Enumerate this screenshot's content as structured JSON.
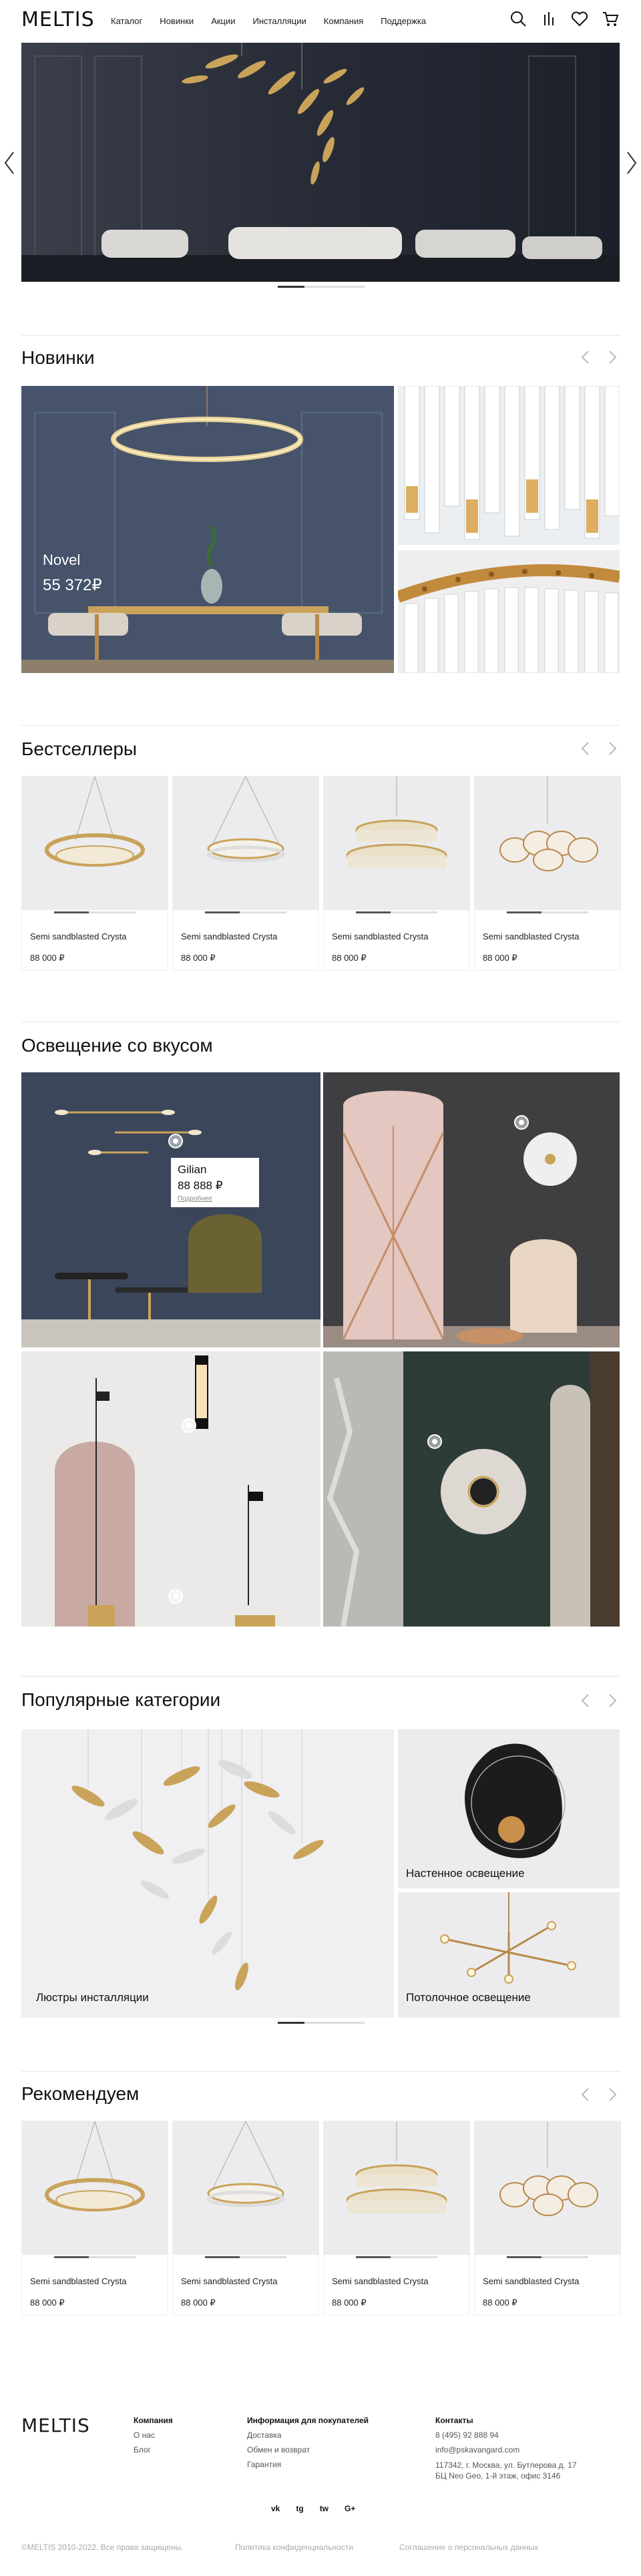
{
  "header": {
    "logo": "MELTIS",
    "nav": [
      "Каталог",
      "Новинки",
      "Акции",
      "Инсталляции",
      "Компания",
      "Поддержка"
    ]
  },
  "sections": {
    "new": "Новинки",
    "bestsellers": "Бестселлеры",
    "taste": "Освещение со вкусом",
    "categories": "Популярные категории",
    "recommend": "Рекомендуем"
  },
  "novel": {
    "name": "Novel",
    "price": "55 372₽"
  },
  "bestsellers": [
    {
      "title": "Semi sandblasted Crysta",
      "price": "88 000 ₽"
    },
    {
      "title": "Semi sandblasted Crysta",
      "price": "88 000 ₽"
    },
    {
      "title": "Semi sandblasted Crysta",
      "price": "88 000 ₽"
    },
    {
      "title": "Semi sandblasted Crysta",
      "price": "88 000 ₽"
    }
  ],
  "recommend": [
    {
      "title": "Semi sandblasted Crysta",
      "price": "88 000 ₽"
    },
    {
      "title": "Semi sandblasted Crysta",
      "price": "88 000 ₽"
    },
    {
      "title": "Semi sandblasted Crysta",
      "price": "88 000 ₽"
    },
    {
      "title": "Semi sandblasted Crysta",
      "price": "88 000 ₽"
    }
  ],
  "tooltip": {
    "name": "Gilian",
    "price": "88 888 ₽",
    "link": "Подробнее"
  },
  "categories": {
    "chandeliers": "Люстры инсталляции",
    "wall": "Настенное освещение",
    "ceiling": "Потолочное освещение"
  },
  "footer": {
    "logo": "MELTIS",
    "company_title": "Компания",
    "company_links": [
      "О нас",
      "Блог"
    ],
    "buyers_title": "Информация для покупателей",
    "buyers_links": [
      "Доставка",
      "Обмен и возврат",
      "Гарантия"
    ],
    "contacts_title": "Контакты",
    "phone": "8 (495) 92 888 94",
    "email": "info@pskavangard.com",
    "address1": "117342, г. Москва, ул. Бутлерова д. 17",
    "address2": "БЦ Neo Geo, 1-й этаж, офис 3146",
    "social": [
      "vk",
      "tg",
      "tw",
      "G+"
    ],
    "copyright": "©MELTIS 2010-2022. Все права защищены.",
    "privacy": "Политика конфиденциальности",
    "consent": "Соглашение о персональных данных"
  },
  "colors": {
    "accent": "#b8894a",
    "hero_wall": "#2f3642",
    "blue_wall": "#46536b",
    "pink": "#e4c7c0"
  }
}
